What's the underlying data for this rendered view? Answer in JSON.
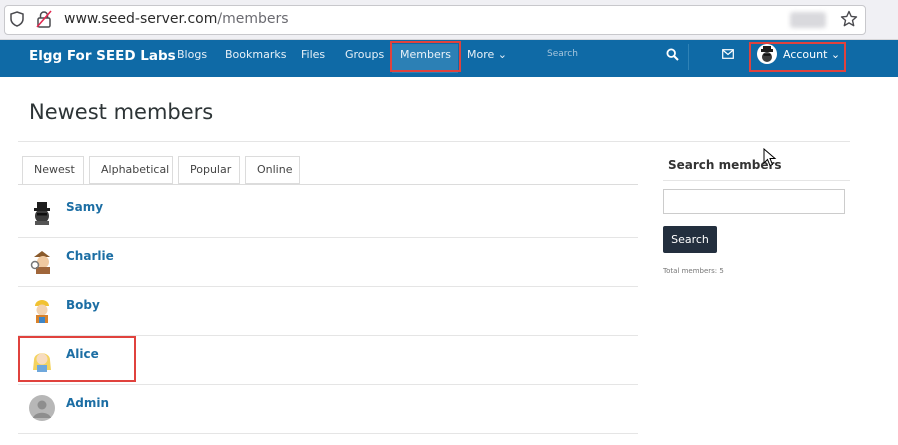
{
  "browser": {
    "url_host": "www.seed-server.com",
    "url_path": "/members"
  },
  "topbar": {
    "brand": "Elgg For SEED Labs",
    "nav": [
      "Blogs",
      "Bookmarks",
      "Files",
      "Groups",
      "Members",
      "More ⌄"
    ],
    "active_nav": "Members",
    "search_placeholder": "Search",
    "account_label": "Account ⌄"
  },
  "page": {
    "title": "Newest members",
    "tabs": [
      "Newest",
      "Alphabetical",
      "Popular",
      "Online"
    ],
    "selected_tab": "Newest",
    "members": [
      {
        "name": "Samy",
        "avatar_icon": "spy-avatar-icon"
      },
      {
        "name": "Charlie",
        "avatar_icon": "detective-avatar-icon"
      },
      {
        "name": "Boby",
        "avatar_icon": "builder-avatar-icon"
      },
      {
        "name": "Alice",
        "avatar_icon": "alice-avatar-icon"
      },
      {
        "name": "Admin",
        "avatar_icon": "default-avatar-icon"
      }
    ]
  },
  "sidebar": {
    "title": "Search members",
    "search_button": "Search",
    "total_members": "Total members: 5"
  },
  "colors": {
    "topbar": "#0f6aa6",
    "link": "#1c6ea4",
    "highlight": "#e0423d",
    "button": "#232f3e"
  }
}
